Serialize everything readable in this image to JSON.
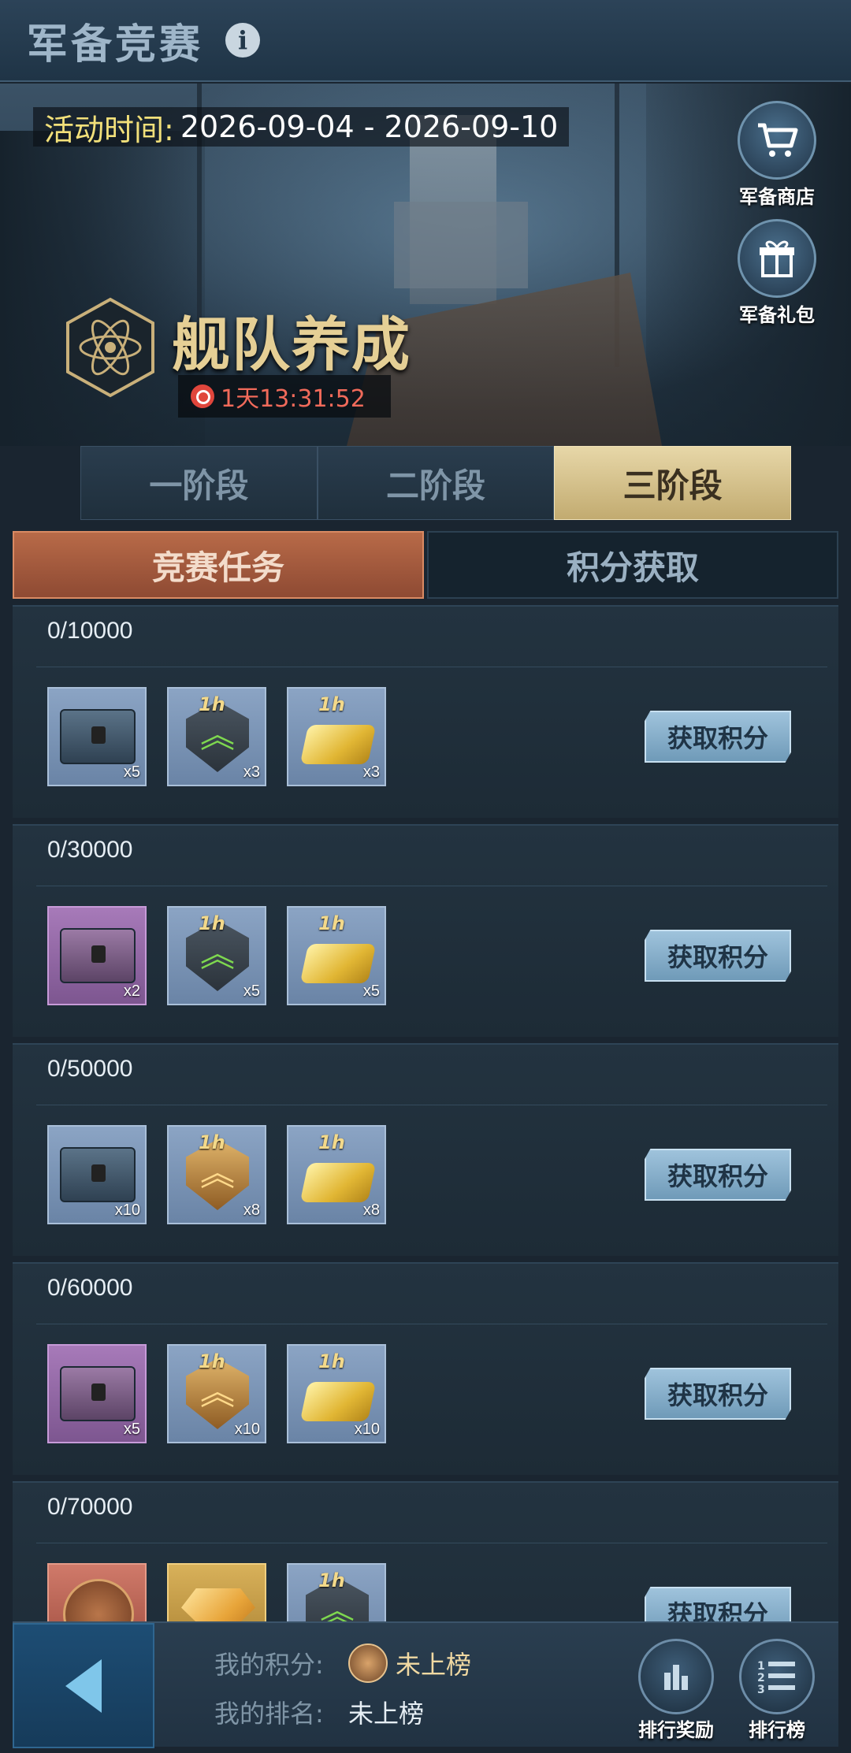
{
  "header": {
    "title": "军备竞赛",
    "info_icon": "info-icon"
  },
  "banner": {
    "event_time_label": "活动时间:",
    "event_time_value": "2026-09-04 - 2026-09-10",
    "stage_title": "舰队养成",
    "countdown": "1天13:31:52",
    "shop_label": "军备商店",
    "gift_label": "军备礼包"
  },
  "stage_tabs": [
    {
      "label": "一阶段",
      "active": false
    },
    {
      "label": "二阶段",
      "active": false
    },
    {
      "label": "三阶段",
      "active": true
    }
  ],
  "main_tabs": [
    {
      "label": "竞赛任务",
      "active": true
    },
    {
      "label": "积分获取",
      "active": false
    }
  ],
  "tasks": [
    {
      "progress": "0/10000",
      "button": "获取积分",
      "items": [
        {
          "icon": "blue-chest-icon",
          "qty": "x5"
        },
        {
          "icon": "green-speedup-1h-icon",
          "qty": "x3"
        },
        {
          "icon": "gold-bar-1h-icon",
          "qty": "x3"
        }
      ]
    },
    {
      "progress": "0/30000",
      "button": "获取积分",
      "items": [
        {
          "icon": "purple-chest-icon",
          "qty": "x2"
        },
        {
          "icon": "green-speedup-1h-icon",
          "qty": "x5"
        },
        {
          "icon": "gold-bar-1h-icon",
          "qty": "x5"
        }
      ]
    },
    {
      "progress": "0/50000",
      "button": "获取积分",
      "items": [
        {
          "icon": "blue-chest-icon",
          "qty": "x10"
        },
        {
          "icon": "gold-speedup-1h-icon",
          "qty": "x8"
        },
        {
          "icon": "gold-bar-1h-icon",
          "qty": "x8"
        }
      ]
    },
    {
      "progress": "0/60000",
      "button": "获取积分",
      "items": [
        {
          "icon": "purple-chest-icon",
          "qty": "x5"
        },
        {
          "icon": "gold-speedup-1h-icon",
          "qty": "x10"
        },
        {
          "icon": "gold-bar-1h-icon",
          "qty": "x10"
        }
      ]
    },
    {
      "progress": "0/70000",
      "button": "获取积分",
      "items": [
        {
          "icon": "red-medal-icon",
          "qty": ""
        },
        {
          "icon": "gold-diamond-icon",
          "qty": ""
        },
        {
          "icon": "green-speedup-1h-icon",
          "qty": ""
        }
      ]
    }
  ],
  "footer": {
    "my_score_label": "我的积分:",
    "my_score_value": "未上榜",
    "my_rank_label": "我的排名:",
    "my_rank_value": "未上榜",
    "rank_reward_label": "排行奖励",
    "leaderboard_label": "排行榜"
  },
  "colors": {
    "accent_gold": "#c2ab70",
    "active_tab": "#b86a48",
    "button": "#9fc3dc",
    "background": "#1a2530"
  }
}
